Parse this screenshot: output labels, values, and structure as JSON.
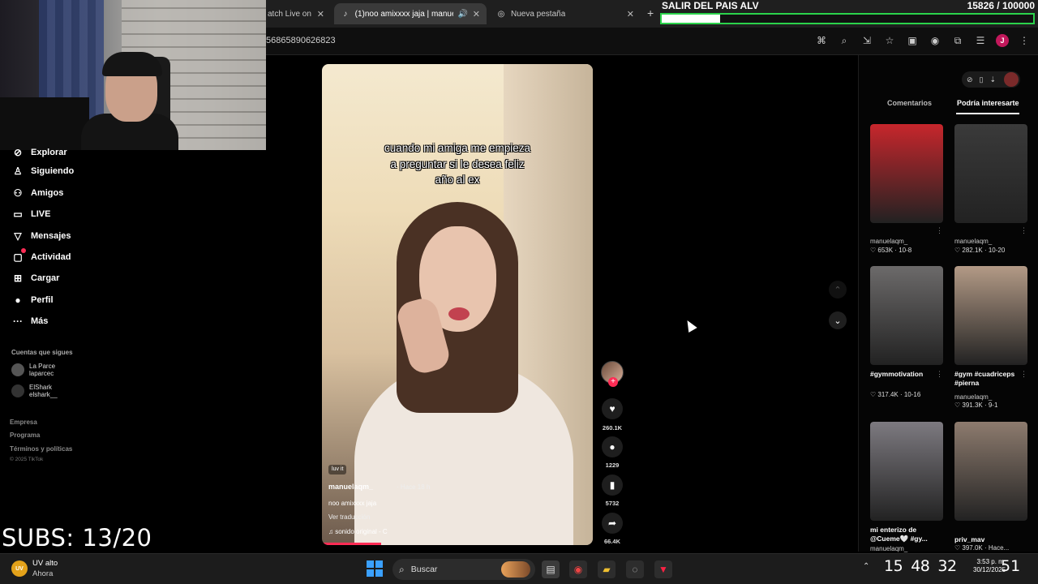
{
  "tabs": [
    {
      "label": "atch Live on",
      "icon": "tiktok-icon"
    },
    {
      "label": "(1)noo amixxxx jaja | manue",
      "icon": "tiktok-icon",
      "active": true
    },
    {
      "label": "Nueva pestaña",
      "icon": "chrome-icon"
    }
  ],
  "address": {
    "url": "56865890626823"
  },
  "goal": {
    "title": "SALIR DEL PAIS ALV",
    "count": "15826 / 100000",
    "progress": 0.158
  },
  "sidebar": {
    "items": [
      {
        "label": "Explorar",
        "icon": "compass-icon"
      },
      {
        "label": "Siguiendo",
        "icon": "person-icon"
      },
      {
        "label": "Amigos",
        "icon": "people-icon"
      },
      {
        "label": "LIVE",
        "icon": "live-icon"
      },
      {
        "label": "Mensajes",
        "icon": "send-icon"
      },
      {
        "label": "Actividad",
        "icon": "activity-icon"
      },
      {
        "label": "Cargar",
        "icon": "upload-icon"
      },
      {
        "label": "Perfil",
        "icon": "profile-icon"
      },
      {
        "label": "Más",
        "icon": "more-icon"
      }
    ],
    "follow_title": "Cuentas que sigues",
    "follows": [
      {
        "name": "La Parce",
        "handle": "laparcec"
      },
      {
        "name": "ElShark",
        "handle": "elshark__"
      }
    ],
    "footer": [
      "Empresa",
      "Programa",
      "Términos y políticas"
    ],
    "copyright": "© 2025 TikTok"
  },
  "subs": "SUBS: 13/20",
  "video": {
    "caption_lines": [
      "cuando mi amiga me empieza",
      "a preguntar si le desea feliz",
      "año al ex"
    ],
    "tag": "luv it",
    "user": "manuelaqm_",
    "time": "· Hace 18 h",
    "desc": "noo amixxxx jaja",
    "translate": "Ver traducción",
    "sound": "♫  sonido original - C",
    "progress": 0.22
  },
  "actions": {
    "likes": "260.1K",
    "comments": "1229",
    "saves": "5732",
    "shares": "66.4K"
  },
  "right_panel": {
    "tabs": [
      "Comentarios",
      "Podría interesarte"
    ],
    "items": [
      {
        "title": "",
        "user": "manuelaqm_",
        "stats": "♡ 653K · 10-8",
        "color": "#c7262c"
      },
      {
        "title": "",
        "user": "manuelaqm_",
        "stats": "♡ 282.1K · 10-20",
        "color": "#3a3a3a"
      },
      {
        "title": "#gymmotivation",
        "user": "",
        "stats": "♡ 317.4K · 10-16",
        "color": "#6c6a6a"
      },
      {
        "title": "#gym #cuadriceps #pierna",
        "user": "manuelaqm_",
        "stats": "♡ 391.3K · 9-1",
        "color": "#b39a86"
      },
      {
        "title": "mi enterizo de @Cueme🤍 #gy...",
        "user": "manuelaqm_",
        "stats": "",
        "color": "#7d7a80"
      },
      {
        "title": "priv_mav",
        "user": "",
        "stats": "♡ 397.0K · Hace...",
        "color": "#8d7b6e"
      }
    ]
  },
  "taskbar": {
    "weather_badge": "UV",
    "weather_title": "UV alto",
    "weather_sub": "Ahora",
    "search": "Buscar",
    "time": "3:53 p. m.",
    "date": "30/12/2025"
  },
  "clock": {
    "h": "15",
    "m": "48",
    "s": "32",
    "ms": "51"
  }
}
